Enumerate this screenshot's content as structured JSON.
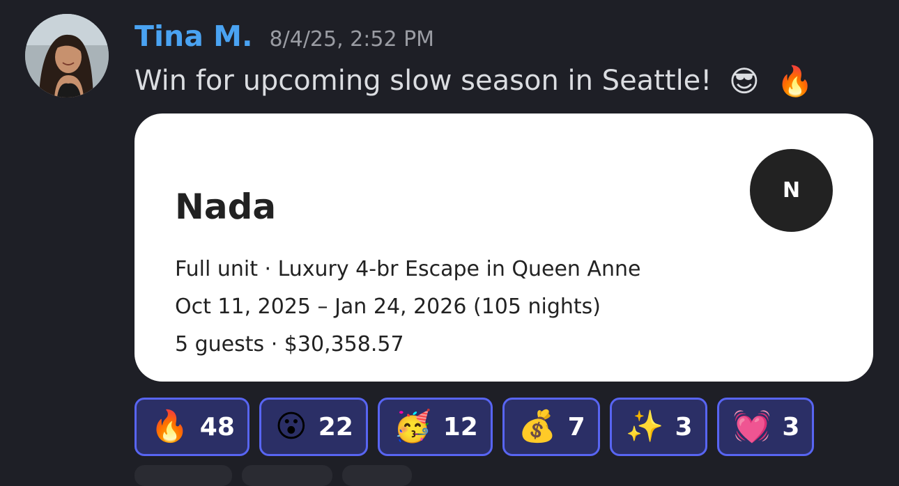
{
  "message": {
    "author": "Tina M.",
    "timestamp": "8/4/25, 2:52 PM",
    "text": "Win for upcoming slow season in Seattle!",
    "emojis": [
      "😎",
      "🔥"
    ]
  },
  "card": {
    "title": "Nada",
    "avatar_initial": "N",
    "line1": "Full unit · Luxury 4-br Escape in Queen Anne",
    "line2": "Oct 11, 2025 – Jan 24, 2026 (105 nights)",
    "line3": "5 guests · $30,358.57"
  },
  "reactions": [
    {
      "emoji": "🔥",
      "count": "48",
      "icon": "fire-icon"
    },
    {
      "emoji": "😮",
      "count": "22",
      "icon": "surprised-face-icon"
    },
    {
      "emoji": "🥳",
      "count": "12",
      "icon": "party-face-icon"
    },
    {
      "emoji": "💰",
      "count": "7",
      "icon": "money-bag-icon"
    },
    {
      "emoji": "✨",
      "count": "3",
      "icon": "sparkles-icon"
    },
    {
      "emoji": "💓",
      "count": "3",
      "icon": "beating-heart-icon"
    }
  ],
  "colors": {
    "background": "#1e1f26",
    "author": "#4aa3f2",
    "reaction_border": "#5865f2",
    "reaction_bg": "#2b2f66"
  }
}
